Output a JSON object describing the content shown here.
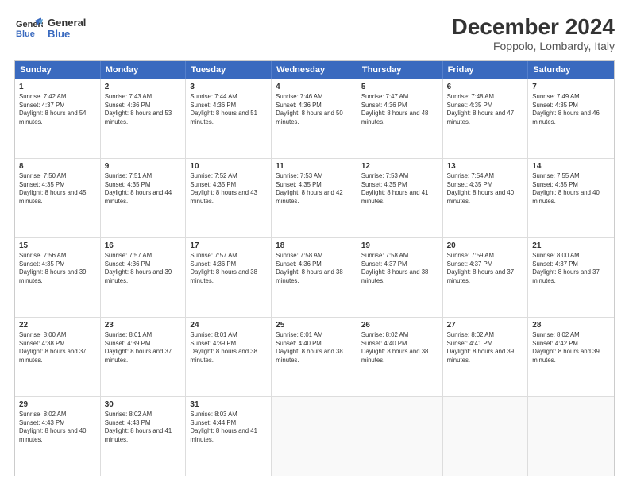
{
  "logo": {
    "line1": "General",
    "line2": "Blue"
  },
  "title": "December 2024",
  "subtitle": "Foppolo, Lombardy, Italy",
  "header": {
    "days": [
      "Sunday",
      "Monday",
      "Tuesday",
      "Wednesday",
      "Thursday",
      "Friday",
      "Saturday"
    ]
  },
  "weeks": [
    {
      "cells": [
        {
          "day": "1",
          "sunrise": "7:42 AM",
          "sunset": "4:37 PM",
          "daylight": "8 hours and 54 minutes"
        },
        {
          "day": "2",
          "sunrise": "7:43 AM",
          "sunset": "4:36 PM",
          "daylight": "8 hours and 53 minutes"
        },
        {
          "day": "3",
          "sunrise": "7:44 AM",
          "sunset": "4:36 PM",
          "daylight": "8 hours and 51 minutes"
        },
        {
          "day": "4",
          "sunrise": "7:46 AM",
          "sunset": "4:36 PM",
          "daylight": "8 hours and 50 minutes"
        },
        {
          "day": "5",
          "sunrise": "7:47 AM",
          "sunset": "4:36 PM",
          "daylight": "8 hours and 48 minutes"
        },
        {
          "day": "6",
          "sunrise": "7:48 AM",
          "sunset": "4:35 PM",
          "daylight": "8 hours and 47 minutes"
        },
        {
          "day": "7",
          "sunrise": "7:49 AM",
          "sunset": "4:35 PM",
          "daylight": "8 hours and 46 minutes"
        }
      ]
    },
    {
      "cells": [
        {
          "day": "8",
          "sunrise": "7:50 AM",
          "sunset": "4:35 PM",
          "daylight": "8 hours and 45 minutes"
        },
        {
          "day": "9",
          "sunrise": "7:51 AM",
          "sunset": "4:35 PM",
          "daylight": "8 hours and 44 minutes"
        },
        {
          "day": "10",
          "sunrise": "7:52 AM",
          "sunset": "4:35 PM",
          "daylight": "8 hours and 43 minutes"
        },
        {
          "day": "11",
          "sunrise": "7:53 AM",
          "sunset": "4:35 PM",
          "daylight": "8 hours and 42 minutes"
        },
        {
          "day": "12",
          "sunrise": "7:53 AM",
          "sunset": "4:35 PM",
          "daylight": "8 hours and 41 minutes"
        },
        {
          "day": "13",
          "sunrise": "7:54 AM",
          "sunset": "4:35 PM",
          "daylight": "8 hours and 40 minutes"
        },
        {
          "day": "14",
          "sunrise": "7:55 AM",
          "sunset": "4:35 PM",
          "daylight": "8 hours and 40 minutes"
        }
      ]
    },
    {
      "cells": [
        {
          "day": "15",
          "sunrise": "7:56 AM",
          "sunset": "4:35 PM",
          "daylight": "8 hours and 39 minutes"
        },
        {
          "day": "16",
          "sunrise": "7:57 AM",
          "sunset": "4:36 PM",
          "daylight": "8 hours and 39 minutes"
        },
        {
          "day": "17",
          "sunrise": "7:57 AM",
          "sunset": "4:36 PM",
          "daylight": "8 hours and 38 minutes"
        },
        {
          "day": "18",
          "sunrise": "7:58 AM",
          "sunset": "4:36 PM",
          "daylight": "8 hours and 38 minutes"
        },
        {
          "day": "19",
          "sunrise": "7:58 AM",
          "sunset": "4:37 PM",
          "daylight": "8 hours and 38 minutes"
        },
        {
          "day": "20",
          "sunrise": "7:59 AM",
          "sunset": "4:37 PM",
          "daylight": "8 hours and 37 minutes"
        },
        {
          "day": "21",
          "sunrise": "8:00 AM",
          "sunset": "4:37 PM",
          "daylight": "8 hours and 37 minutes"
        }
      ]
    },
    {
      "cells": [
        {
          "day": "22",
          "sunrise": "8:00 AM",
          "sunset": "4:38 PM",
          "daylight": "8 hours and 37 minutes"
        },
        {
          "day": "23",
          "sunrise": "8:01 AM",
          "sunset": "4:39 PM",
          "daylight": "8 hours and 37 minutes"
        },
        {
          "day": "24",
          "sunrise": "8:01 AM",
          "sunset": "4:39 PM",
          "daylight": "8 hours and 38 minutes"
        },
        {
          "day": "25",
          "sunrise": "8:01 AM",
          "sunset": "4:40 PM",
          "daylight": "8 hours and 38 minutes"
        },
        {
          "day": "26",
          "sunrise": "8:02 AM",
          "sunset": "4:40 PM",
          "daylight": "8 hours and 38 minutes"
        },
        {
          "day": "27",
          "sunrise": "8:02 AM",
          "sunset": "4:41 PM",
          "daylight": "8 hours and 39 minutes"
        },
        {
          "day": "28",
          "sunrise": "8:02 AM",
          "sunset": "4:42 PM",
          "daylight": "8 hours and 39 minutes"
        }
      ]
    },
    {
      "cells": [
        {
          "day": "29",
          "sunrise": "8:02 AM",
          "sunset": "4:43 PM",
          "daylight": "8 hours and 40 minutes"
        },
        {
          "day": "30",
          "sunrise": "8:02 AM",
          "sunset": "4:43 PM",
          "daylight": "8 hours and 41 minutes"
        },
        {
          "day": "31",
          "sunrise": "8:03 AM",
          "sunset": "4:44 PM",
          "daylight": "8 hours and 41 minutes"
        },
        {
          "day": "",
          "sunrise": "",
          "sunset": "",
          "daylight": ""
        },
        {
          "day": "",
          "sunrise": "",
          "sunset": "",
          "daylight": ""
        },
        {
          "day": "",
          "sunrise": "",
          "sunset": "",
          "daylight": ""
        },
        {
          "day": "",
          "sunrise": "",
          "sunset": "",
          "daylight": ""
        }
      ]
    }
  ]
}
